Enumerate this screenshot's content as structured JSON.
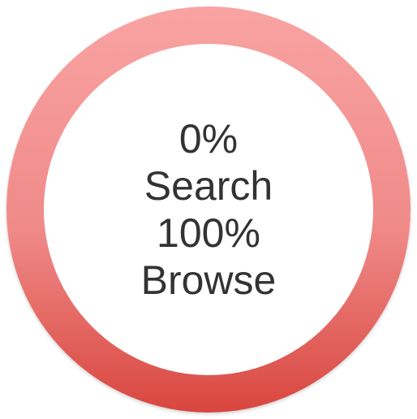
{
  "badge": {
    "lines": [
      "0%",
      "Search",
      "100%",
      "Browse"
    ],
    "colors": {
      "ring_top": "#f9a3a3",
      "ring_mid": "#ef8a88",
      "ring_bottom": "#d9463f",
      "center": "#ffffff",
      "text": "#333333"
    }
  }
}
